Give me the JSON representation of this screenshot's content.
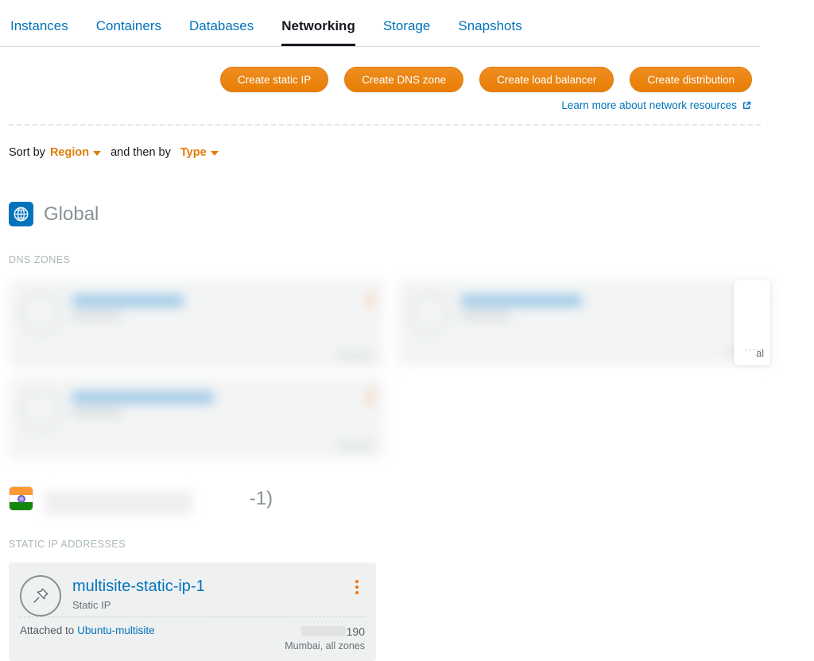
{
  "tabs": [
    {
      "label": "Instances",
      "active": false
    },
    {
      "label": "Containers",
      "active": false
    },
    {
      "label": "Databases",
      "active": false
    },
    {
      "label": "Networking",
      "active": true
    },
    {
      "label": "Storage",
      "active": false
    },
    {
      "label": "Snapshots",
      "active": false
    }
  ],
  "actions": {
    "create_static_ip": "Create static IP",
    "create_dns_zone": "Create DNS zone",
    "create_load_balancer": "Create load balancer",
    "create_distribution": "Create distribution",
    "learn_more": "Learn more about network resources"
  },
  "sort": {
    "prefix": "Sort by",
    "primary": "Region",
    "middle": "and then by",
    "secondary": "Type"
  },
  "regions": [
    {
      "name": "Global",
      "icon": "globe-icon",
      "sections": [
        {
          "label": "DNS ZONES",
          "cards": [
            {
              "title": "",
              "subtitle": "",
              "redacted": true,
              "footer": ""
            },
            {
              "title": "",
              "subtitle": "",
              "redacted": true,
              "footer": ""
            },
            {
              "title": "",
              "subtitle": "",
              "redacted": true,
              "footer": ""
            }
          ]
        }
      ]
    },
    {
      "name": "",
      "name_suffix": "-1)",
      "icon": "india-flag-icon",
      "redacted_name": true,
      "sections": [
        {
          "label": "STATIC IP ADDRESSES",
          "cards": [
            {
              "title": "multisite-static-ip-1",
              "subtitle": "Static IP",
              "attached_prefix": "Attached to",
              "attached_target": "Ubuntu-multisite",
              "ip_visible_suffix": "190",
              "ip_masked": true,
              "zone": "Mumbai, all zones",
              "redacted": false
            }
          ]
        }
      ]
    }
  ],
  "overlay_card": {
    "partial_text": "al"
  },
  "colors": {
    "link": "#0073bb",
    "accent_orange": "#ec7211",
    "button_orange": "#e87e04",
    "text_dark": "#16191f",
    "text_muted": "#545b64",
    "label_gray": "#aab7b8",
    "card_bg": "#eff1f1"
  }
}
